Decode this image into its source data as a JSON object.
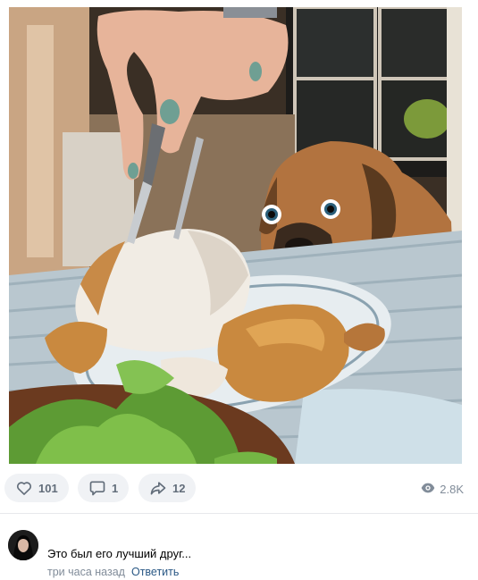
{
  "post": {
    "image": {
      "subject": "dog",
      "colors": {
        "tablecloth": "#b9c7cf",
        "chicken": "#c9893f",
        "meat": "#f1ece4",
        "dog": "#b2733f",
        "lettuce": "#5d9b34",
        "plate": "#6b3a1f"
      }
    },
    "actions": {
      "likes": "101",
      "comments": "1",
      "shares": "12",
      "views": "2.8K"
    }
  },
  "comment": {
    "text": "Это был его лучший друг...",
    "time": "три часа назад",
    "reply_label": "Ответить"
  },
  "colors": {
    "pill_bg": "#f0f2f5",
    "icon": "#626d7a",
    "muted": "#818c99",
    "link": "#2a5885"
  },
  "icons": [
    "heart-icon",
    "comment-icon",
    "share-icon",
    "eye-icon"
  ]
}
